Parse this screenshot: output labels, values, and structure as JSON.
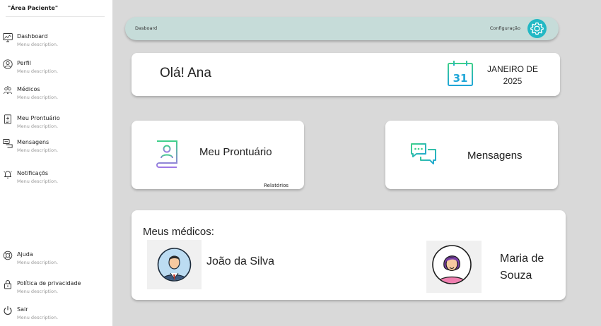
{
  "sidebar": {
    "title": "\"Área  Paciente\"",
    "top_items": [
      {
        "label": "Dashboard",
        "desc": "Menu description.",
        "icon": "dashboard-icon"
      },
      {
        "label": "Perfil",
        "desc": "Menu description.",
        "icon": "profile-icon"
      },
      {
        "label": "Médicos",
        "desc": "Menu description.",
        "icon": "doctors-icon"
      },
      {
        "label": "Meu Prontuário",
        "desc": "Menu description.",
        "icon": "medical-record-icon"
      },
      {
        "label": "Mensagens",
        "desc": "Menu description.",
        "icon": "messages-icon"
      },
      {
        "label": "Notificaçõs",
        "desc": "Menu description.",
        "icon": "notifications-icon"
      }
    ],
    "bottom_items": [
      {
        "label": "Ajuda",
        "desc": "Menu description.",
        "icon": "help-icon"
      },
      {
        "label": "Política de privacidade",
        "desc": "Menu description.",
        "icon": "lock-icon"
      },
      {
        "label": "Sair",
        "desc": "Menu description.",
        "icon": "power-icon"
      }
    ]
  },
  "topbar": {
    "breadcrumb": "Dasboard",
    "config_label": "Configuração",
    "config_icon": "gear-icon"
  },
  "greeting": {
    "text": "Olá! Ana",
    "calendar_day": "31",
    "month": "JANEIRO DE",
    "year": "2025"
  },
  "cards": {
    "prontuario_label": "Meu Prontuário",
    "reports_link": "Relatórios",
    "messages_label": "Mensagens"
  },
  "doctors": {
    "title": "Meus médicos:",
    "list": [
      {
        "name": "João da Silva"
      },
      {
        "name": "Maria de Souza"
      }
    ]
  },
  "colors": {
    "accent_teal": "#22b8c4",
    "topbar_bg": "#c6dcd9",
    "page_bg": "#d9d9d9"
  }
}
